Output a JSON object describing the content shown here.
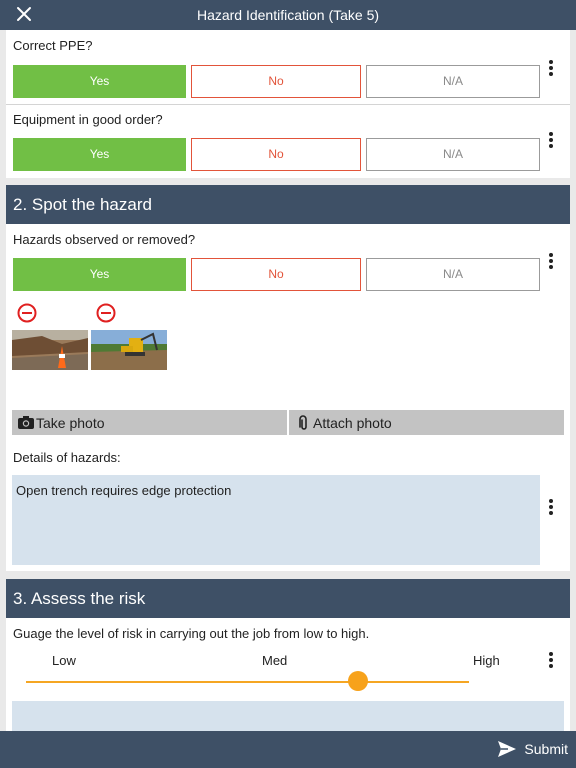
{
  "header": {
    "title": "Hazard Identification (Take 5)"
  },
  "options": {
    "yes": "Yes",
    "no": "No",
    "na": "N/A"
  },
  "questions": {
    "ppe": "Correct PPE?",
    "equipment": "Equipment in good order?",
    "hazards": "Hazards observed or removed?"
  },
  "section2": {
    "title": "2. Spot the hazard"
  },
  "photos": {
    "take_label": "Take photo",
    "attach_label": "Attach photo"
  },
  "details": {
    "label": "Details of hazards:",
    "value": "Open trench requires edge protection"
  },
  "section3": {
    "title": "3. Assess the risk",
    "prompt": "Guage the level of risk in carrying out the job from low to high.",
    "scale": {
      "low": "Low",
      "med": "Med",
      "high": "High"
    },
    "selected_level_fraction": 0.75,
    "accent_color": "#f7a21b"
  },
  "footer": {
    "submit_label": "Submit"
  },
  "colors": {
    "header_bg": "#3e5066",
    "yes_green": "#71bf45",
    "no_red": "#e2543a"
  }
}
